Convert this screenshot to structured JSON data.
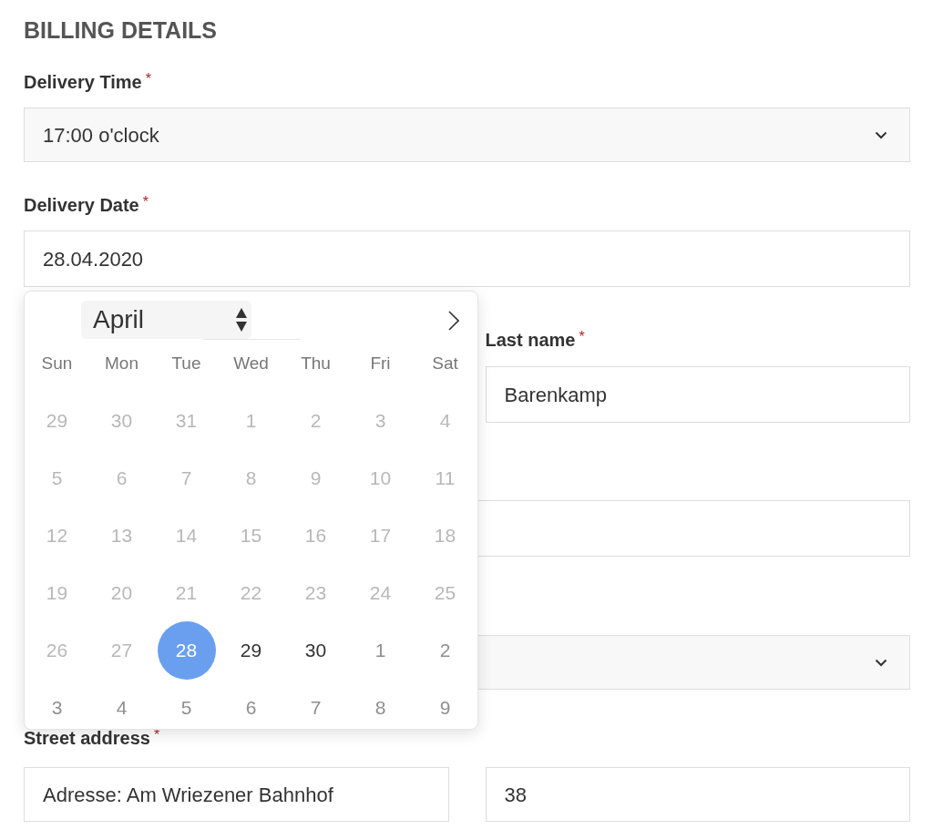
{
  "heading": "BILLING DETAILS",
  "delivery_time": {
    "label": "Delivery Time",
    "mark": "*",
    "value": "17:00 o'clock"
  },
  "delivery_date": {
    "label": "Delivery Date",
    "mark": "*",
    "value": "28.04.2020"
  },
  "date_picker": {
    "month": "April",
    "weekdays": [
      "Sun",
      "Mon",
      "Tue",
      "Wed",
      "Thu",
      "Fri",
      "Sat"
    ],
    "weeks": [
      [
        {
          "day": "29",
          "disabled": true,
          "selected": false
        },
        {
          "day": "30",
          "disabled": true,
          "selected": false
        },
        {
          "day": "31",
          "disabled": true,
          "selected": false
        },
        {
          "day": "1",
          "disabled": true,
          "selected": false
        },
        {
          "day": "2",
          "disabled": true,
          "selected": false
        },
        {
          "day": "3",
          "disabled": true,
          "selected": false
        },
        {
          "day": "4",
          "disabled": true,
          "selected": false
        }
      ],
      [
        {
          "day": "5",
          "disabled": true,
          "selected": false
        },
        {
          "day": "6",
          "disabled": true,
          "selected": false
        },
        {
          "day": "7",
          "disabled": true,
          "selected": false
        },
        {
          "day": "8",
          "disabled": true,
          "selected": false
        },
        {
          "day": "9",
          "disabled": true,
          "selected": false
        },
        {
          "day": "10",
          "disabled": true,
          "selected": false
        },
        {
          "day": "11",
          "disabled": true,
          "selected": false
        }
      ],
      [
        {
          "day": "12",
          "disabled": true,
          "selected": false
        },
        {
          "day": "13",
          "disabled": true,
          "selected": false
        },
        {
          "day": "14",
          "disabled": true,
          "selected": false
        },
        {
          "day": "15",
          "disabled": true,
          "selected": false
        },
        {
          "day": "16",
          "disabled": true,
          "selected": false
        },
        {
          "day": "17",
          "disabled": true,
          "selected": false
        },
        {
          "day": "18",
          "disabled": true,
          "selected": false
        }
      ],
      [
        {
          "day": "19",
          "disabled": true,
          "selected": false
        },
        {
          "day": "20",
          "disabled": true,
          "selected": false
        },
        {
          "day": "21",
          "disabled": true,
          "selected": false
        },
        {
          "day": "22",
          "disabled": true,
          "selected": false
        },
        {
          "day": "23",
          "disabled": true,
          "selected": false
        },
        {
          "day": "24",
          "disabled": true,
          "selected": false
        },
        {
          "day": "25",
          "disabled": true,
          "selected": false
        }
      ],
      [
        {
          "day": "26",
          "disabled": true,
          "selected": false
        },
        {
          "day": "27",
          "disabled": true,
          "selected": false
        },
        {
          "day": "28",
          "disabled": false,
          "selected": true
        },
        {
          "day": "29",
          "disabled": false,
          "outside_month": false,
          "selected": false
        },
        {
          "day": "30",
          "disabled": false,
          "outside_month": false,
          "selected": false
        },
        {
          "day": "1",
          "disabled": false,
          "outside_month": true,
          "selected": false
        },
        {
          "day": "2",
          "disabled": false,
          "outside_month": true,
          "selected": false
        }
      ],
      [
        {
          "day": "3",
          "disabled": false,
          "outside_month": true,
          "selected": false
        },
        {
          "day": "4",
          "disabled": false,
          "outside_month": true,
          "selected": false
        },
        {
          "day": "5",
          "disabled": false,
          "outside_month": true,
          "selected": false
        },
        {
          "day": "6",
          "disabled": false,
          "outside_month": true,
          "selected": false
        },
        {
          "day": "7",
          "disabled": false,
          "outside_month": true,
          "selected": false
        },
        {
          "day": "8",
          "disabled": false,
          "outside_month": true,
          "selected": false
        },
        {
          "day": "9",
          "disabled": false,
          "outside_month": true,
          "selected": false
        }
      ]
    ]
  },
  "last_name": {
    "label": "Last name",
    "mark": "*",
    "value": "Barenkamp"
  },
  "hidden_fields": [
    {
      "kind": "text"
    },
    {
      "kind": "select"
    }
  ],
  "street": {
    "label": "Street address",
    "mark": "*",
    "value": "Adresse: Am Wriezener Bahnhof",
    "number": "38"
  }
}
